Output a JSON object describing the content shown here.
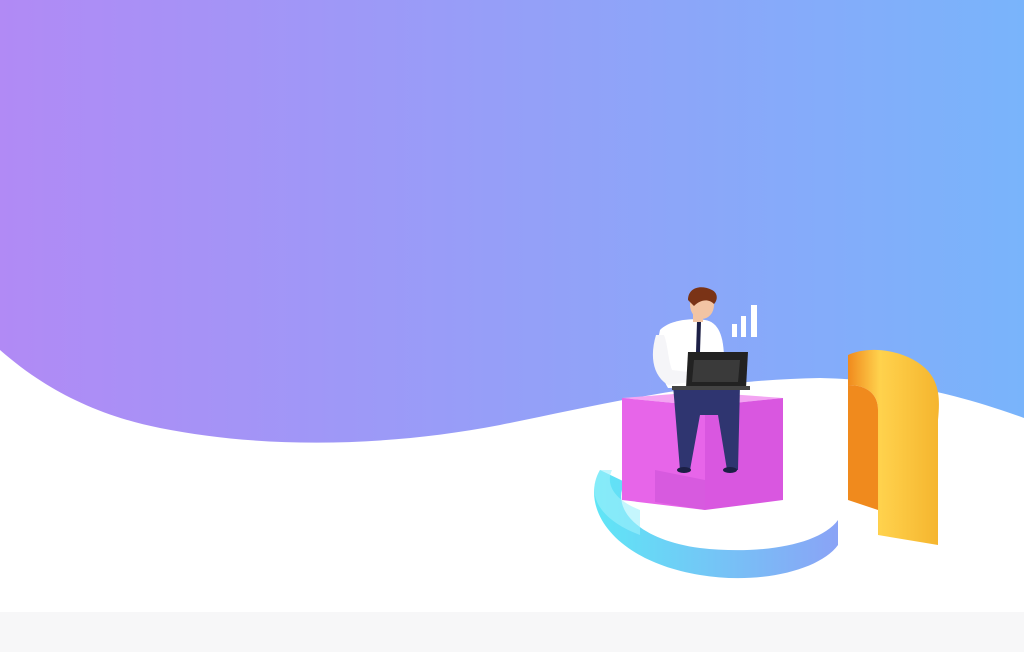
{
  "scene": {
    "background_gradient": {
      "from": "#b18af5",
      "to": "#79b4fb"
    },
    "ground_color": "#ffffff",
    "footer_strip_color": "#f7f7f8",
    "illustration": {
      "subject": "person-with-laptop-on-chart-blocks",
      "colors": {
        "pink_block": "#e765e9",
        "pink_block_top": "#f3a4f2",
        "ring_start": "#5fe6f6",
        "ring_end": "#8aa3f6",
        "yellow_arc": "#ffd24d",
        "orange_arc": "#f08a1d",
        "shirt": "#ffffff",
        "pants": "#2f3570",
        "hair": "#7a3316",
        "skin": "#f2c4a4",
        "laptop": "#222222",
        "bar_icon": "#ffffff"
      }
    }
  }
}
